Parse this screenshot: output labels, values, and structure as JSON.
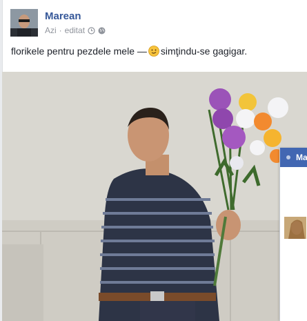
{
  "post": {
    "author": "Marean",
    "time": "Azi",
    "edited": "editat",
    "separator": "·",
    "status_text": "florikele pentru pezdele mele —",
    "feeling": "simţindu-se gagigar."
  },
  "chat": {
    "name_preview": "Ma"
  },
  "icons": {
    "clock": "clock-icon",
    "audience": "globe-icon",
    "feeling": "smiley-emoji-icon"
  },
  "colors": {
    "link": "#365899",
    "meta": "#90949c",
    "chat_header": "#4267b2"
  }
}
